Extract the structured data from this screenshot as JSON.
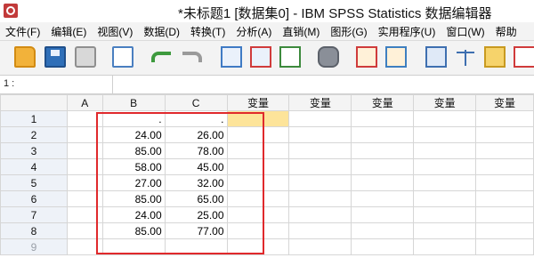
{
  "window": {
    "title": "*未标题1 [数据集0] - IBM SPSS Statistics 数据编辑器"
  },
  "menu": [
    "文件(F)",
    "编辑(E)",
    "视图(V)",
    "数据(D)",
    "转换(T)",
    "分析(A)",
    "直销(M)",
    "图形(G)",
    "实用程序(U)",
    "窗口(W)",
    "帮助"
  ],
  "toolbar_icons": [
    "open-folder-icon",
    "save-icon",
    "print-icon",
    "dialog-recall-icon",
    "undo-icon",
    "redo-icon",
    "goto-case-icon",
    "goto-variable-icon",
    "variables-icon",
    "find-icon",
    "insert-cases-icon",
    "insert-variable-icon",
    "split-file-icon",
    "weight-cases-icon",
    "select-cases-icon",
    "value-labels-icon"
  ],
  "cell_ref": "1 :",
  "grid": {
    "columns": [
      "A",
      "B",
      "C",
      "变量",
      "变量",
      "变量",
      "变量",
      "变量"
    ],
    "rows": [
      {
        "num": "1",
        "A": "",
        "B": ".",
        "C": "."
      },
      {
        "num": "2",
        "A": "",
        "B": "24.00",
        "C": "26.00"
      },
      {
        "num": "3",
        "A": "",
        "B": "85.00",
        "C": "78.00"
      },
      {
        "num": "4",
        "A": "",
        "B": "58.00",
        "C": "45.00"
      },
      {
        "num": "5",
        "A": "",
        "B": "27.00",
        "C": "32.00"
      },
      {
        "num": "6",
        "A": "",
        "B": "85.00",
        "C": "65.00"
      },
      {
        "num": "7",
        "A": "",
        "B": "24.00",
        "C": "25.00"
      },
      {
        "num": "8",
        "A": "",
        "B": "85.00",
        "C": "77.00"
      },
      {
        "num": "9",
        "A": "",
        "B": "",
        "C": ""
      }
    ]
  },
  "colors": {
    "highlight": "#e0292c",
    "active_cell": "#fde49a"
  }
}
